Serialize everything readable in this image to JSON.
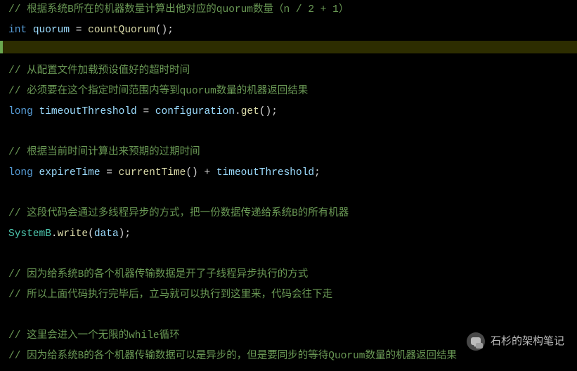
{
  "lines": [
    {
      "segments": [
        {
          "cls": "comment",
          "t": "// 根据系统B所在的机器数量计算出他对应的quorum数量（n / 2 + 1）"
        }
      ]
    },
    {
      "segments": [
        {
          "cls": "keyword",
          "t": "int"
        },
        {
          "cls": "punct",
          "t": " "
        },
        {
          "cls": "ident",
          "t": "quorum"
        },
        {
          "cls": "punct",
          "t": " = "
        },
        {
          "cls": "func",
          "t": "countQuorum"
        },
        {
          "cls": "punct",
          "t": "();"
        }
      ]
    },
    {
      "segments": [
        {
          "cls": "punct",
          "t": ""
        }
      ]
    },
    {
      "segments": [
        {
          "cls": "comment",
          "t": "// 从配置文件加载预设值好的超时时间"
        }
      ]
    },
    {
      "segments": [
        {
          "cls": "comment",
          "t": "// 必须要在这个指定时间范围内等到quorum数量的机器返回结果"
        }
      ]
    },
    {
      "segments": [
        {
          "cls": "keyword",
          "t": "long"
        },
        {
          "cls": "punct",
          "t": " "
        },
        {
          "cls": "ident",
          "t": "timeoutThreshold"
        },
        {
          "cls": "punct",
          "t": " = "
        },
        {
          "cls": "ident",
          "t": "configuration"
        },
        {
          "cls": "punct",
          "t": "."
        },
        {
          "cls": "func",
          "t": "get"
        },
        {
          "cls": "punct",
          "t": "();"
        }
      ]
    },
    {
      "segments": [
        {
          "cls": "punct",
          "t": ""
        }
      ]
    },
    {
      "segments": [
        {
          "cls": "comment",
          "t": "// 根据当前时间计算出来预期的过期时间"
        }
      ]
    },
    {
      "segments": [
        {
          "cls": "keyword",
          "t": "long"
        },
        {
          "cls": "punct",
          "t": " "
        },
        {
          "cls": "ident",
          "t": "expireTime"
        },
        {
          "cls": "punct",
          "t": " = "
        },
        {
          "cls": "func",
          "t": "currentTime"
        },
        {
          "cls": "punct",
          "t": "() + "
        },
        {
          "cls": "ident",
          "t": "timeoutThreshold"
        },
        {
          "cls": "punct",
          "t": ";"
        }
      ]
    },
    {
      "segments": [
        {
          "cls": "punct",
          "t": ""
        }
      ]
    },
    {
      "segments": [
        {
          "cls": "comment",
          "t": "// 这段代码会通过多线程异步的方式，把一份数据传递给系统B的所有机器"
        }
      ]
    },
    {
      "segments": [
        {
          "cls": "class",
          "t": "SystemB"
        },
        {
          "cls": "punct",
          "t": "."
        },
        {
          "cls": "func",
          "t": "write"
        },
        {
          "cls": "punct",
          "t": "("
        },
        {
          "cls": "ident",
          "t": "data"
        },
        {
          "cls": "punct",
          "t": ");"
        }
      ]
    },
    {
      "segments": [
        {
          "cls": "punct",
          "t": ""
        }
      ]
    },
    {
      "segments": [
        {
          "cls": "comment",
          "t": "// 因为给系统B的各个机器传输数据是开了子线程异步执行的方式"
        }
      ]
    },
    {
      "segments": [
        {
          "cls": "comment",
          "t": "// 所以上面代码执行完毕后，立马就可以执行到这里来，代码会往下走"
        }
      ]
    },
    {
      "segments": [
        {
          "cls": "punct",
          "t": ""
        }
      ]
    },
    {
      "segments": [
        {
          "cls": "comment",
          "t": "// 这里会进入一个无限的while循环"
        }
      ]
    },
    {
      "segments": [
        {
          "cls": "comment",
          "t": "// 因为给系统B的各个机器传输数据可以是异步的，但是要同步的等待Quorum数量的机器返回结果"
        }
      ]
    }
  ],
  "watermark": {
    "text": "石杉的架构笔记"
  }
}
